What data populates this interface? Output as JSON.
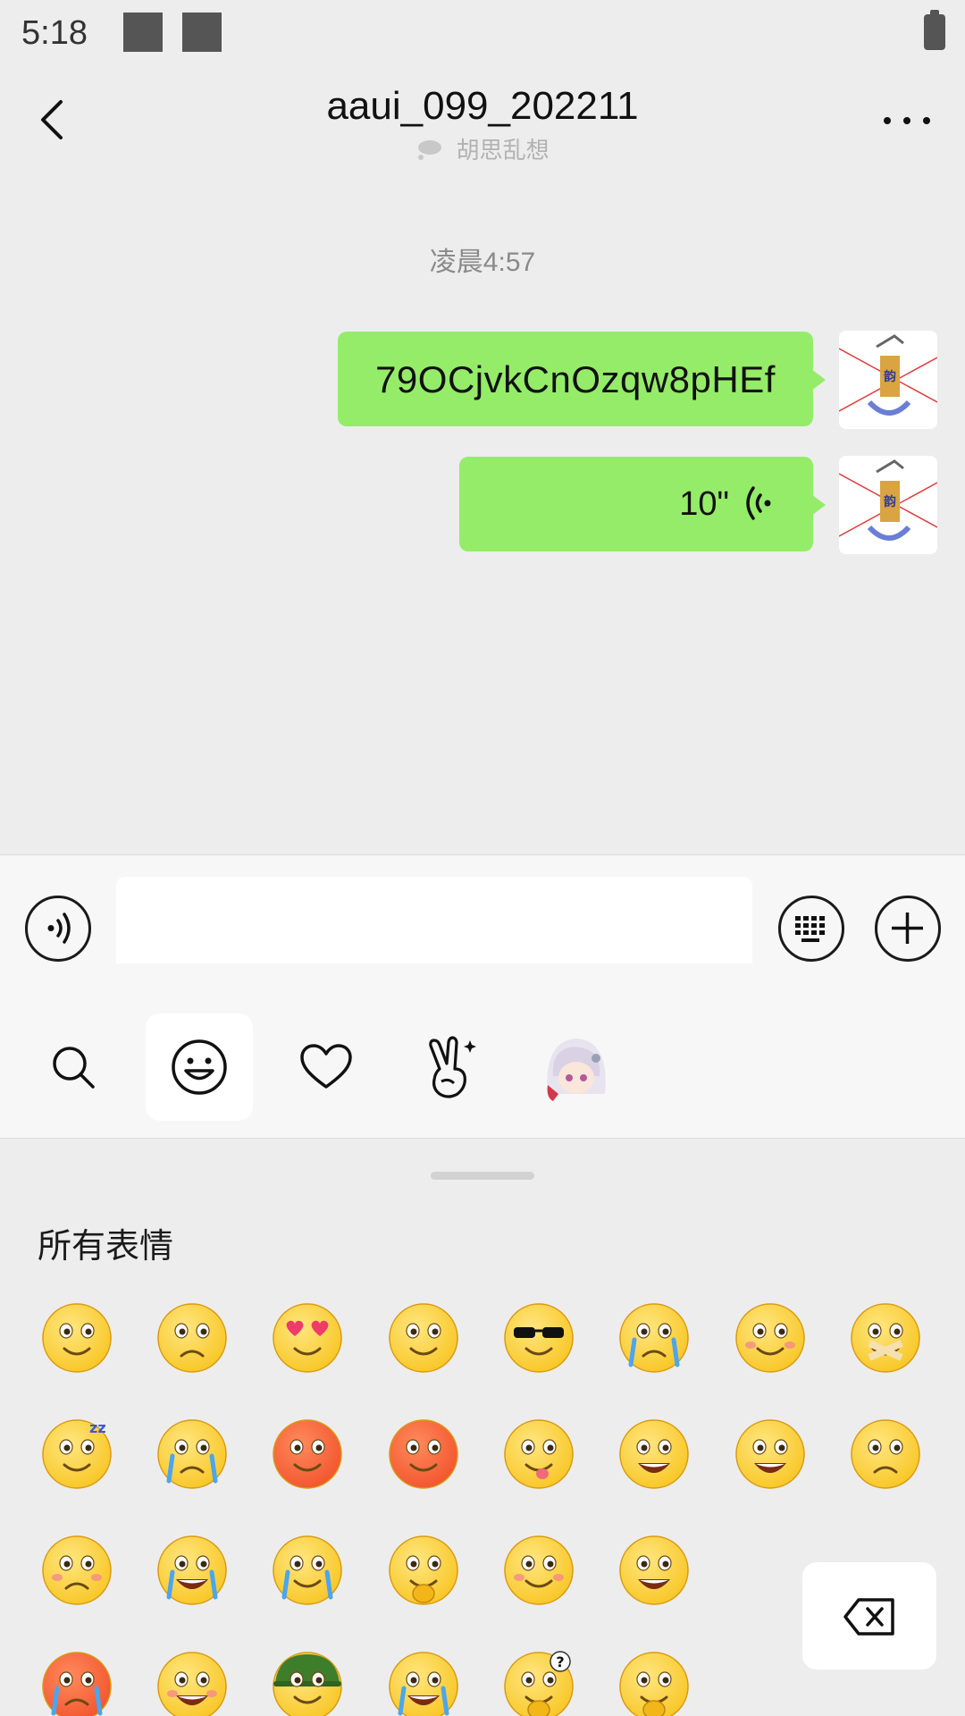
{
  "status": {
    "time": "5:18"
  },
  "header": {
    "title": "aaui_099_202211",
    "subtitle": "胡思乱想"
  },
  "chat": {
    "timestamp": "凌晨4:57",
    "messages": [
      {
        "type": "text",
        "text": "79OCjvkCnOzqw8pHEf"
      },
      {
        "type": "voice",
        "duration": "10\""
      }
    ]
  },
  "input": {
    "placeholder": "",
    "value": ""
  },
  "tabs": [
    "search",
    "emoji",
    "favorites",
    "stickers",
    "custom-sticker"
  ],
  "emoji_panel": {
    "section_title": "所有表情",
    "emojis": [
      "smile",
      "awkward",
      "heart-eyes",
      "shocked",
      "cool",
      "crying",
      "shy",
      "shut-up",
      "sleep",
      "tears",
      "angry-flushed",
      "rage",
      "tongue",
      "grin",
      "surprised",
      "sad",
      "embarrassed",
      "laugh-cry",
      "sick",
      "face-palm",
      "blush",
      "wow",
      "terrified",
      "happy",
      "soldier",
      "crying-laugh",
      "question",
      "hush"
    ]
  },
  "colors": {
    "bubble": "#95ec69",
    "background": "#ededed",
    "panel": "#f7f7f7"
  }
}
